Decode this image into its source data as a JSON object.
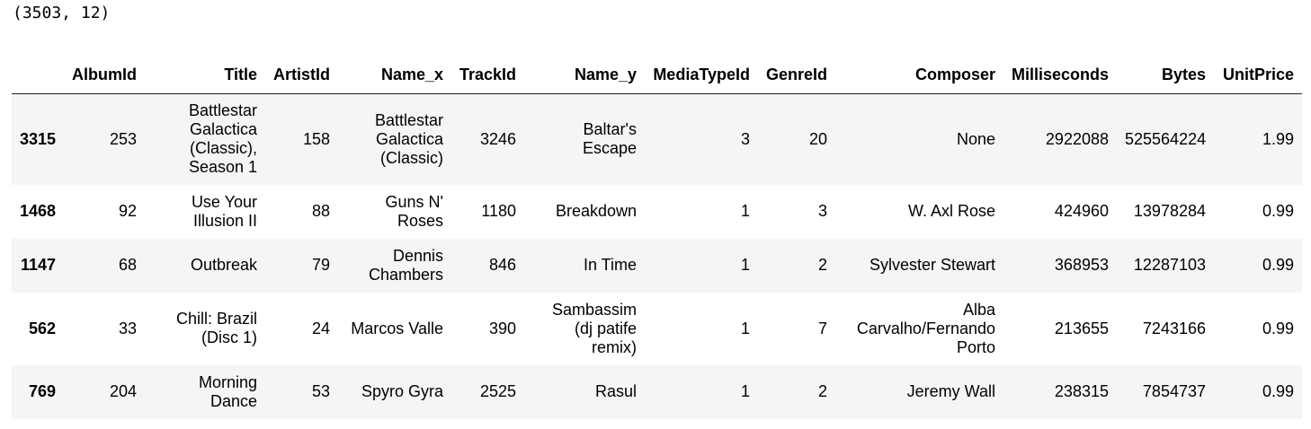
{
  "output": {
    "shape_text": "(3503, 12)"
  },
  "table": {
    "index_header": "",
    "columns": [
      "AlbumId",
      "Title",
      "ArtistId",
      "Name_x",
      "TrackId",
      "Name_y",
      "MediaTypeId",
      "GenreId",
      "Composer",
      "Milliseconds",
      "Bytes",
      "UnitPrice"
    ],
    "rows": [
      {
        "index": "3315",
        "cells": [
          "253",
          "Battlestar Galactica (Classic), Season 1",
          "158",
          "Battlestar Galactica (Classic)",
          "3246",
          "Baltar's Escape",
          "3",
          "20",
          "None",
          "2922088",
          "525564224",
          "1.99"
        ]
      },
      {
        "index": "1468",
        "cells": [
          "92",
          "Use Your Illusion II",
          "88",
          "Guns N' Roses",
          "1180",
          "Breakdown",
          "1",
          "3",
          "W. Axl Rose",
          "424960",
          "13978284",
          "0.99"
        ]
      },
      {
        "index": "1147",
        "cells": [
          "68",
          "Outbreak",
          "79",
          "Dennis Chambers",
          "846",
          "In Time",
          "1",
          "2",
          "Sylvester Stewart",
          "368953",
          "12287103",
          "0.99"
        ]
      },
      {
        "index": "562",
        "cells": [
          "33",
          "Chill: Brazil (Disc 1)",
          "24",
          "Marcos Valle",
          "390",
          "Sambassim (dj patife remix)",
          "1",
          "7",
          "Alba Carvalho/Fernando Porto",
          "213655",
          "7243166",
          "0.99"
        ]
      },
      {
        "index": "769",
        "cells": [
          "204",
          "Morning Dance",
          "53",
          "Spyro Gyra",
          "2525",
          "Rasul",
          "1",
          "2",
          "Jeremy Wall",
          "238315",
          "7854737",
          "0.99"
        ]
      }
    ]
  }
}
